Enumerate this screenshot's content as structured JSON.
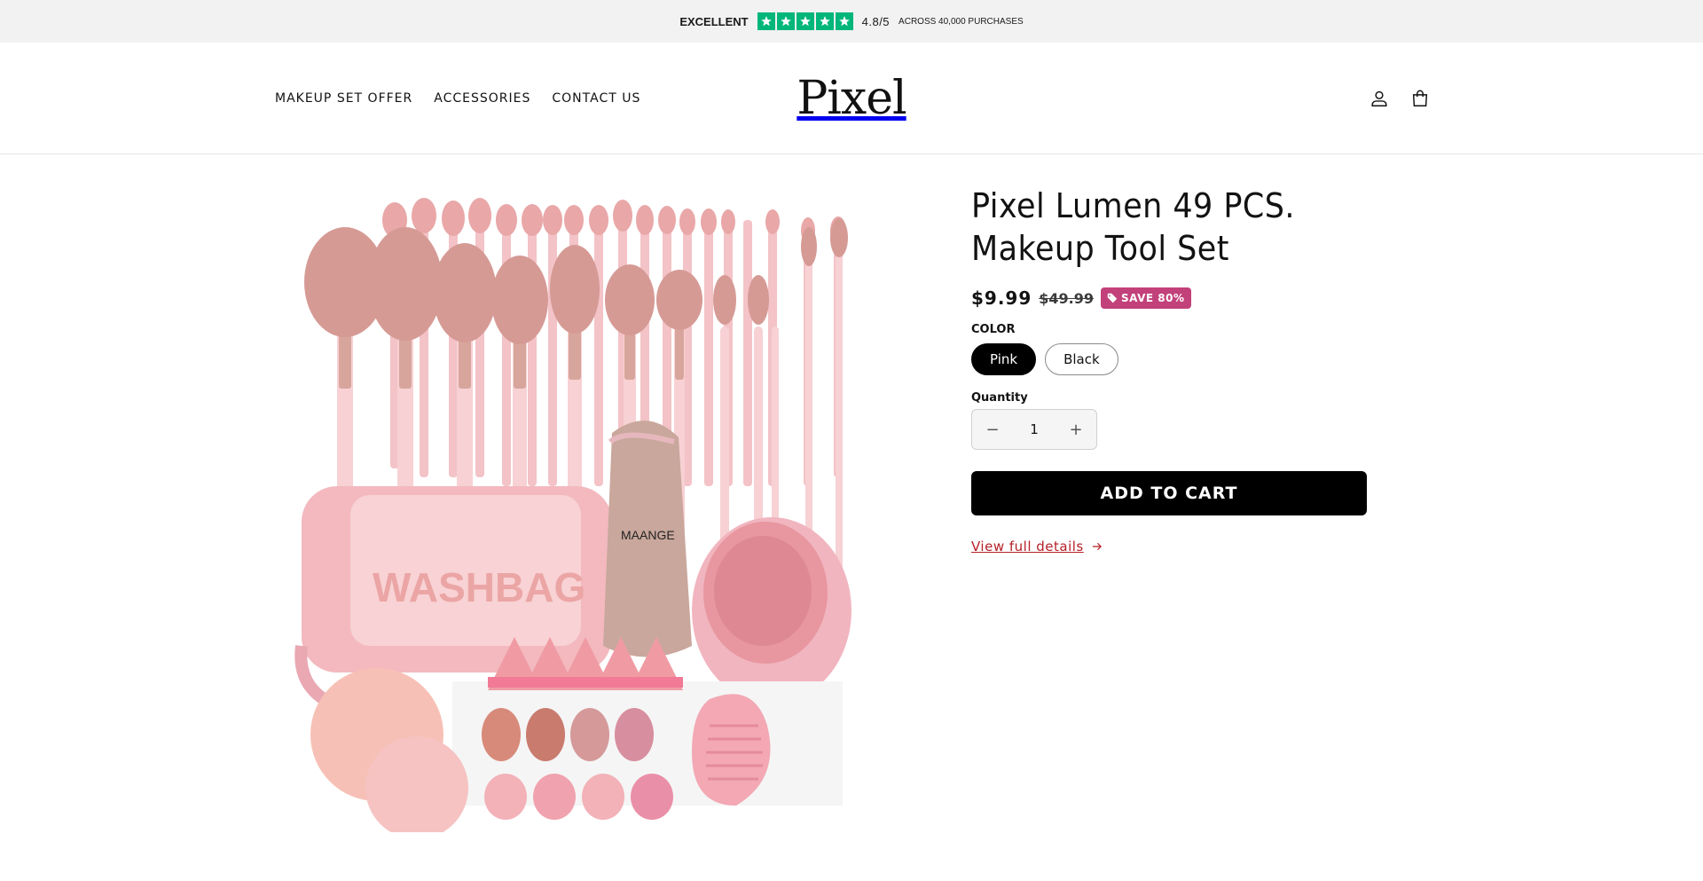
{
  "announcement": {
    "rating_word": "EXCELLENT",
    "score": "4.8/5",
    "purchases": "ACROSS 40,000 PURCHASES",
    "star_color": "#00b67a"
  },
  "header": {
    "logo_text": "Pixel",
    "nav": [
      {
        "label": "MAKEUP SET OFFER"
      },
      {
        "label": "ACCESSORIES"
      },
      {
        "label": "CONTACT US"
      }
    ],
    "icons": [
      "account-icon",
      "cart-icon"
    ]
  },
  "product": {
    "title_line1": "Pixel Lumen 49 PCS.",
    "title_line2": "Makeup Tool Set",
    "price": "$9.99",
    "compare_price": "$49.99",
    "badge": "SAVE 80%",
    "badge_color": "#c2417a",
    "color_label": "COLOR",
    "colors": [
      {
        "label": "Pink",
        "selected": true
      },
      {
        "label": "Black",
        "selected": false
      }
    ],
    "quantity_label": "Quantity",
    "quantity": "1",
    "add_to_cart": "ADD TO CART",
    "view_details": "View full details",
    "link_color": "#b52026"
  }
}
